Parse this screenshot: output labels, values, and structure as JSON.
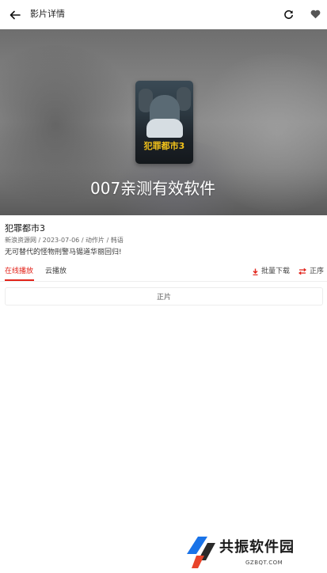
{
  "header": {
    "title": "影片详情",
    "back_icon": "arrow-left-icon",
    "refresh_icon": "refresh-icon",
    "favorite_icon": "heart-icon"
  },
  "hero": {
    "poster_title": "犯罪都市3",
    "overlay_text": "007亲测有效软件"
  },
  "movie": {
    "title": "犯罪都市3",
    "meta": "新浪资源网 / 2023-07-06 / 动作片 / 韩语",
    "description": "无可替代的怪物刑警马锡道华丽回归!"
  },
  "tabs": {
    "online": "在线播放",
    "cloud": "云播放",
    "active": "online"
  },
  "actions": {
    "batch_download": "批量下载",
    "order": "正序"
  },
  "episodes": [
    "正片"
  ],
  "footer_logo": {
    "name": "共振软件园",
    "site": "GZBQT.COM"
  },
  "colors": {
    "accent": "#e2231a",
    "text": "#222222",
    "muted": "#666666"
  }
}
